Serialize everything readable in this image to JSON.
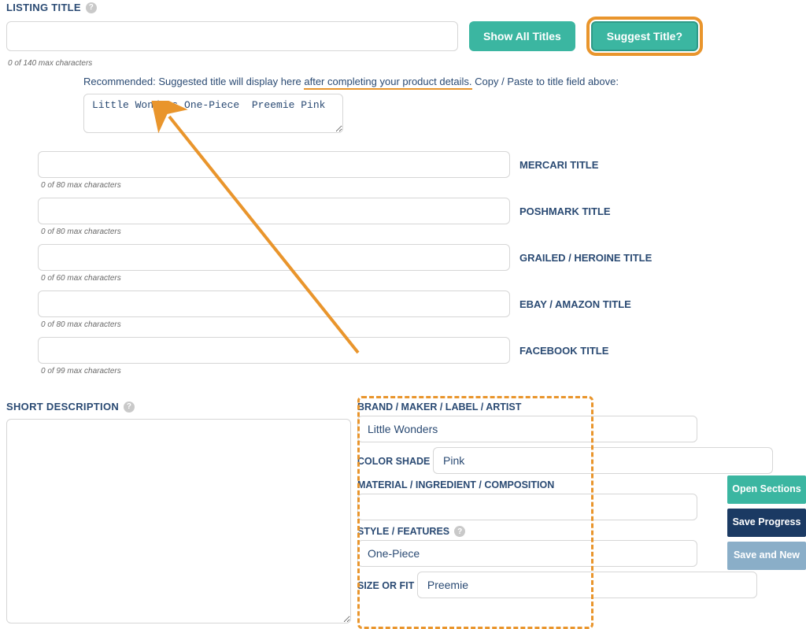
{
  "listingTitle": {
    "label": "LISTING TITLE",
    "value": "",
    "hint": "0 of 140 max characters"
  },
  "buttons": {
    "showAll": "Show All Titles",
    "suggest": "Suggest Title?"
  },
  "recommend": {
    "prefix": "Recommended: Suggested title will display here ",
    "underlined": "after completing your product details.",
    "suffix": " Copy / Paste to title field above:"
  },
  "suggestedTitle": "Little Wonders One-Piece  Preemie Pink",
  "platformTitles": [
    {
      "label": "MERCARI TITLE",
      "hint": "0 of 80 max characters",
      "value": ""
    },
    {
      "label": "POSHMARK TITLE",
      "hint": "0 of 80 max characters",
      "value": ""
    },
    {
      "label": "GRAILED / HEROINE TITLE",
      "hint": "0 of 60 max characters",
      "value": ""
    },
    {
      "label": "EBAY / AMAZON TITLE",
      "hint": "0 of 80 max characters",
      "value": ""
    },
    {
      "label": "FACEBOOK TITLE",
      "hint": "0 of 99 max characters",
      "value": ""
    }
  ],
  "shortDesc": {
    "label": "SHORT DESCRIPTION",
    "value": ""
  },
  "details": [
    {
      "label": "BRAND / MAKER / LABEL / ARTIST",
      "value": "Little Wonders",
      "help": false
    },
    {
      "label": "COLOR SHADE",
      "value": "Pink",
      "help": false
    },
    {
      "label": "MATERIAL / INGREDIENT / COMPOSITION",
      "value": "",
      "help": false
    },
    {
      "label": "STYLE / FEATURES",
      "value": "One-Piece",
      "help": true
    },
    {
      "label": "SIZE OR FIT",
      "value": "Preemie",
      "help": false
    }
  ],
  "floatButtons": {
    "open": "Open Sections",
    "progress": "Save Progress",
    "new": "Save and New"
  }
}
